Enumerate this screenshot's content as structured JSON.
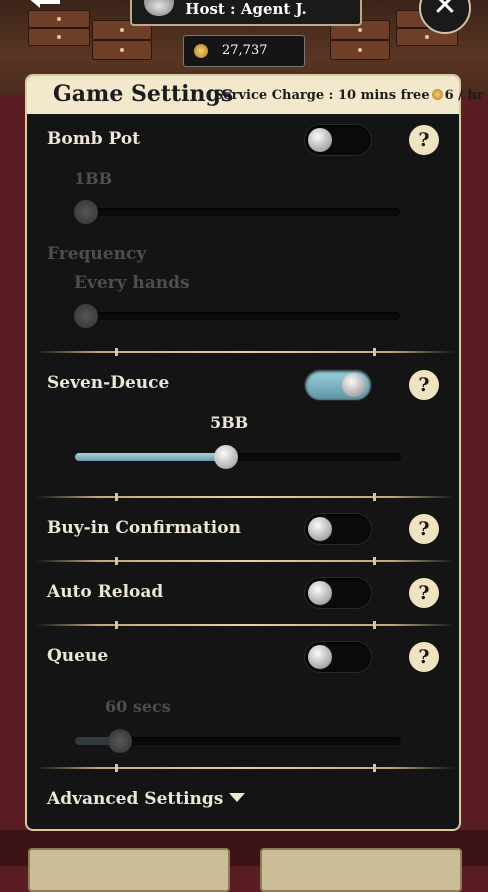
{
  "topbar": {
    "host_label": "Host : Agent J.",
    "coins": "27,737"
  },
  "panel": {
    "title": "Game Settings",
    "service_prefix": "Service Charge : 10 mins free",
    "service_suffix": "6 / hr"
  },
  "bomb_pot": {
    "label": "Bomb Pot",
    "enabled": false,
    "amount": "1BB",
    "amount_level": 0,
    "frequency_label": "Frequency",
    "frequency_value": "Every hands",
    "frequency_level": 0
  },
  "seven_deuce": {
    "label": "Seven-Deuce",
    "enabled": true,
    "amount": "5BB",
    "amount_level": 0.46
  },
  "buyin_confirmation": {
    "label": "Buy-in Confirmation",
    "enabled": false
  },
  "auto_reload": {
    "label": "Auto Reload",
    "enabled": false
  },
  "queue": {
    "label": "Queue",
    "enabled": false,
    "time": "60 secs",
    "time_level": 0.11
  },
  "advanced": {
    "label": "Advanced Settings"
  },
  "colors": {
    "accent": "#7fb3c2",
    "panel_border": "#d9c9a0",
    "header_bg": "#f3e8cc"
  }
}
